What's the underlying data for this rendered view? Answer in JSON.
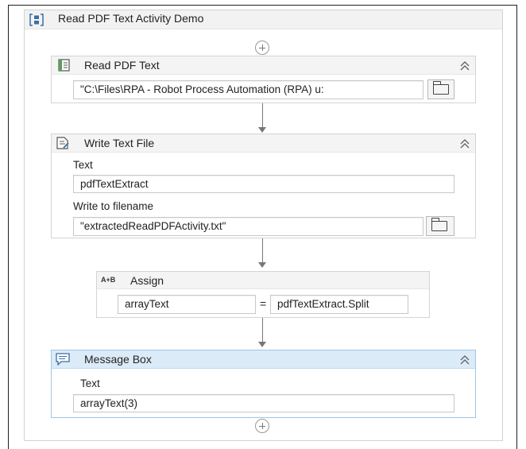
{
  "sequence": {
    "title": "Read PDF Text Activity Demo",
    "icon": "sequence-icon",
    "add_icon": "plus-circle-icon"
  },
  "read_pdf": {
    "title": "Read PDF Text",
    "icon": "read-pdf-icon",
    "filename_value": "\"C:\\Files\\RPA - Robot Process Automation (RPA) u:"
  },
  "write_text": {
    "title": "Write Text File",
    "icon": "write-file-icon",
    "text_label": "Text",
    "text_value": "pdfTextExtract",
    "filename_label": "Write to filename",
    "filename_value": "\"extractedReadPDFActivity.txt\""
  },
  "assign": {
    "title": "Assign",
    "icon_text": "A+B",
    "to_value": "arrayText",
    "operator": "=",
    "value": "pdfTextExtract.Split"
  },
  "message_box": {
    "title": "Message Box",
    "icon": "message-box-icon",
    "text_label": "Text",
    "text_value": "arrayText(3)"
  },
  "colors": {
    "selected_header": "#dcebf8",
    "selected_border": "#9cc6e8",
    "connector": "#777777"
  }
}
